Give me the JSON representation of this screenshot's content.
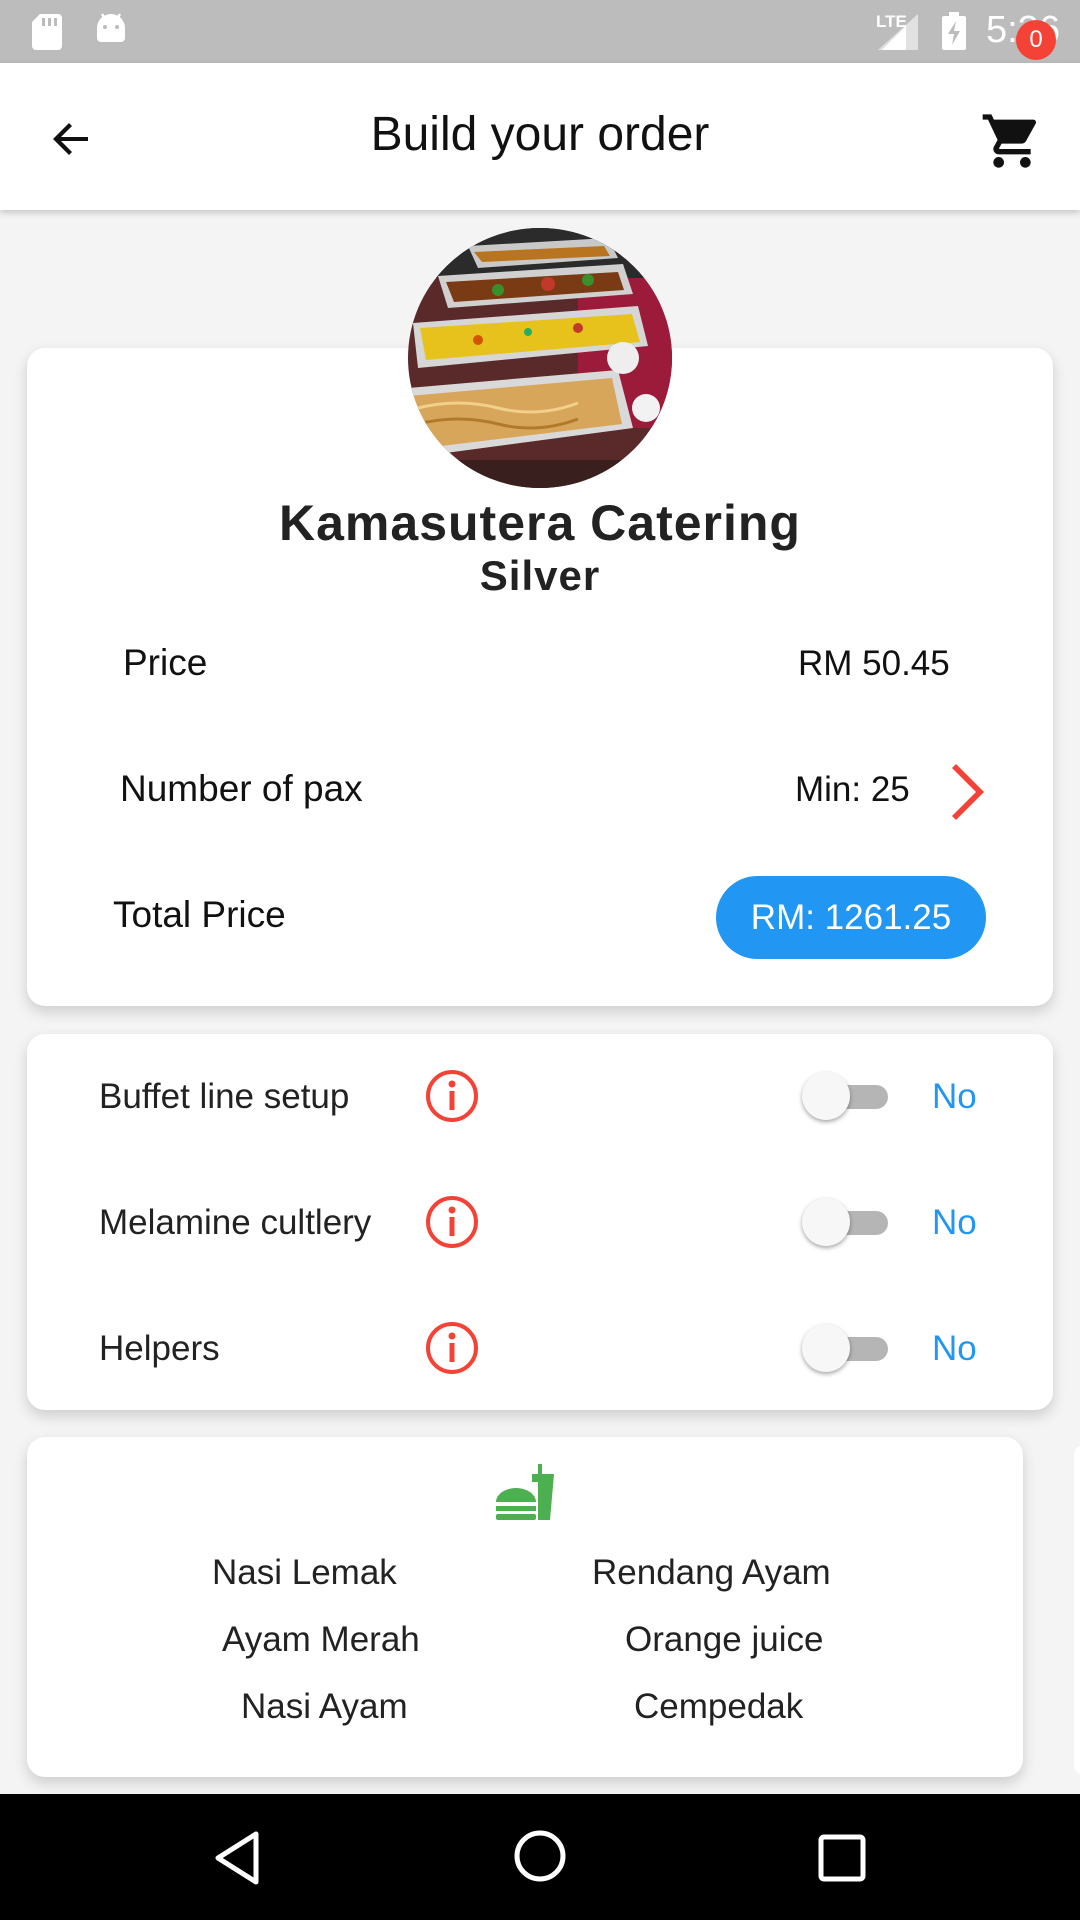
{
  "status_bar": {
    "network": "LTE",
    "time": "5:36",
    "icons": [
      "sd-card-icon",
      "android-icon",
      "signal-icon",
      "battery-charging-icon"
    ]
  },
  "app_bar": {
    "title": "Build your order",
    "back_icon": "arrow-back-icon",
    "cart_icon": "shopping-cart-icon",
    "cart_count": "0"
  },
  "vendor": {
    "name": "Kamasutera Catering",
    "package": "Silver",
    "image": "buffet-food-photo"
  },
  "summary": {
    "price_label": "Price",
    "price_value": "RM 50.45",
    "pax_label": "Number of pax",
    "pax_value": "Min: 25",
    "total_label": "Total Price",
    "total_value": "RM: 1261.25"
  },
  "options": [
    {
      "label": "Buffet line setup",
      "value": "No",
      "enabled": false
    },
    {
      "label": "Melamine cultlery",
      "value": "No",
      "enabled": false
    },
    {
      "label": "Helpers",
      "value": "No",
      "enabled": false
    }
  ],
  "menu": {
    "icon": "fastfood-icon",
    "items": [
      "Nasi Lemak",
      "Rendang Ayam",
      "Ayam Merah",
      "Orange juice",
      "Nasi Ayam",
      "Cempedak"
    ]
  },
  "colors": {
    "accent_blue": "#2196f3",
    "accent_red": "#f44336",
    "food_green": "#4caf50",
    "status_bar": "#bcbcbc"
  }
}
